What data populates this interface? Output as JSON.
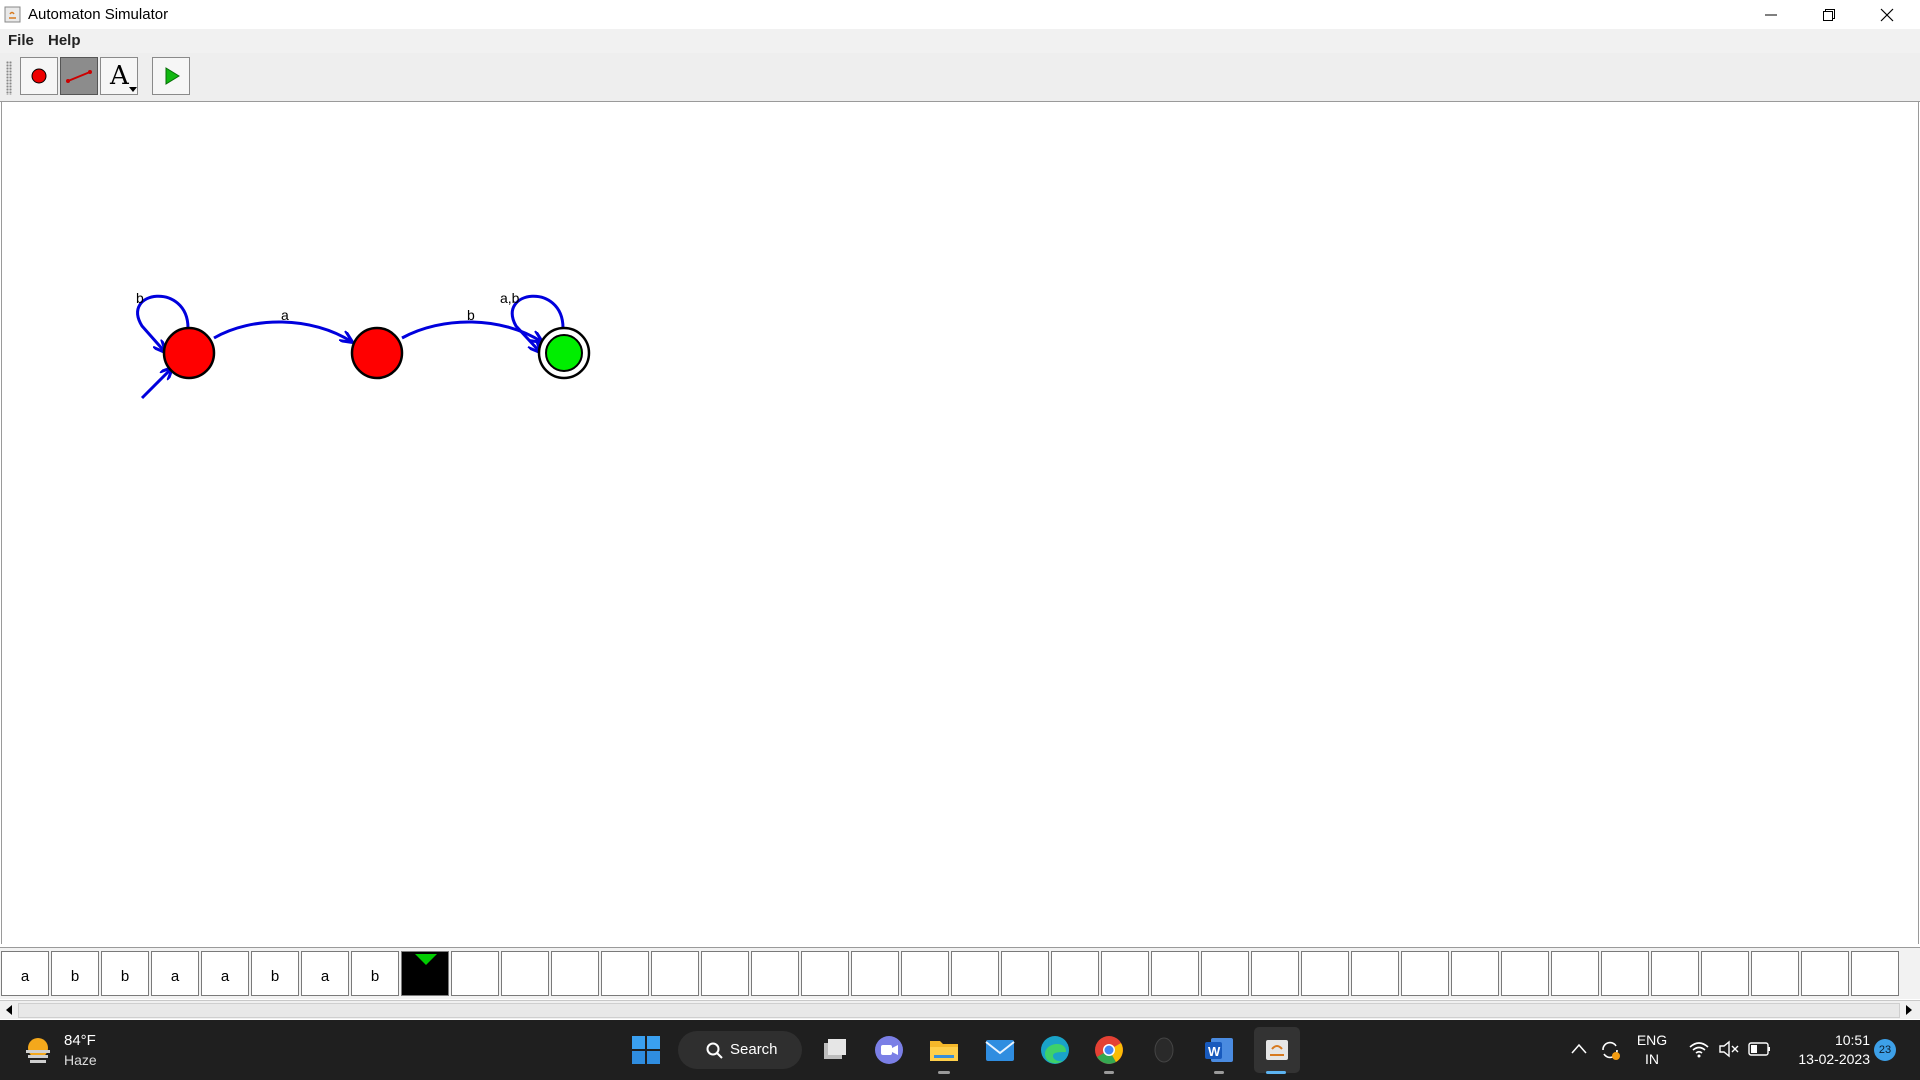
{
  "window": {
    "title": "Automaton Simulator"
  },
  "menu": [
    "File",
    "Help"
  ],
  "toolbar": {
    "tools": [
      {
        "icon": "state-tool-icon"
      },
      {
        "icon": "transition-tool-icon",
        "active": true
      },
      {
        "icon": "label-tool-icon",
        "glyph": "A"
      },
      {
        "icon": "run-icon"
      }
    ]
  },
  "automaton": {
    "states": [
      {
        "id": "q0",
        "initial": true,
        "accepting": false,
        "color": "#ff0000"
      },
      {
        "id": "q1",
        "initial": false,
        "accepting": false,
        "color": "#ff0000"
      },
      {
        "id": "q2",
        "initial": false,
        "accepting": true,
        "color": "#00ee00"
      }
    ],
    "transitions": [
      {
        "from": "q0",
        "to": "q0",
        "label": "b"
      },
      {
        "from": "q0",
        "to": "q1",
        "label": "a"
      },
      {
        "from": "q1",
        "to": "q2",
        "label": "b"
      },
      {
        "from": "q2",
        "to": "q2",
        "label": "a,b"
      }
    ],
    "edge_color": "#0000dd"
  },
  "tape": {
    "symbols": [
      "a",
      "b",
      "b",
      "a",
      "a",
      "b",
      "a",
      "b"
    ],
    "head_index": 8,
    "head_color": "#00cc00"
  },
  "taskbar": {
    "weather": {
      "temp": "84°F",
      "desc": "Haze"
    },
    "search_label": "Search",
    "tray": {
      "lang_line1": "ENG",
      "lang_line2": "IN",
      "time": "10:51",
      "date": "13-02-2023",
      "notifications": "23"
    }
  }
}
